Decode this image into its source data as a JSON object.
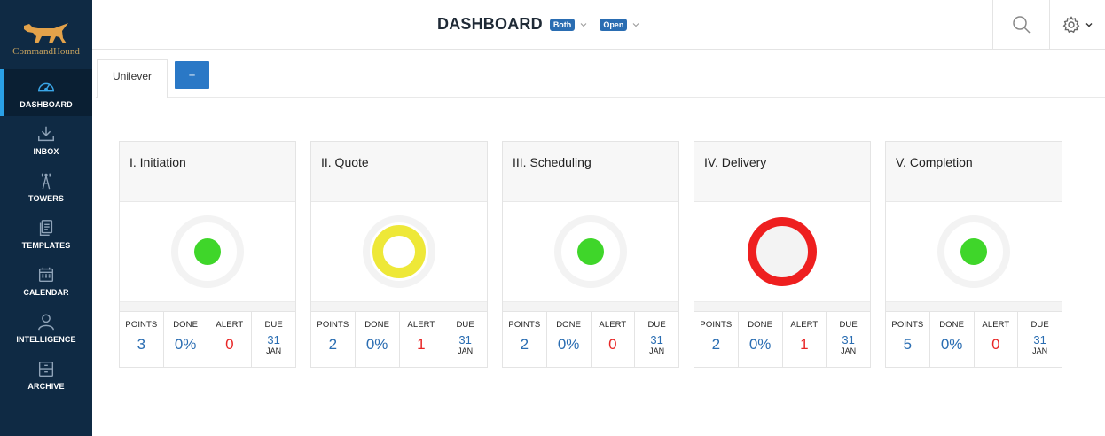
{
  "app": {
    "logo_text": "CommandHound"
  },
  "sidebar": {
    "items": [
      {
        "label": "DASHBOARD",
        "icon": "speedometer-icon",
        "active": true
      },
      {
        "label": "INBOX",
        "icon": "download-tray-icon"
      },
      {
        "label": "TOWERS",
        "icon": "tower-icon"
      },
      {
        "label": "TEMPLATES",
        "icon": "documents-icon"
      },
      {
        "label": "CALENDAR",
        "icon": "calendar-icon"
      },
      {
        "label": "INTELLIGENCE",
        "icon": "person-icon"
      },
      {
        "label": "ARCHIVE",
        "icon": "archive-box-icon"
      }
    ]
  },
  "header": {
    "title": "DASHBOARD",
    "filter1": "Both",
    "filter2": "Open",
    "search_icon": "search-icon",
    "settings_icon": "gear-icon"
  },
  "tabs": {
    "active": "Unilever",
    "add_label": "+"
  },
  "stat_labels": {
    "points": "POINTS",
    "done": "DONE",
    "alert": "ALERT",
    "due": "DUE"
  },
  "cards": [
    {
      "title": "I. Initiation",
      "status": "green",
      "points": "3",
      "done": "0%",
      "alert": "0",
      "due_day": "31",
      "due_month": "JAN"
    },
    {
      "title": "II. Quote",
      "status": "yellow",
      "points": "2",
      "done": "0%",
      "alert": "1",
      "due_day": "31",
      "due_month": "JAN"
    },
    {
      "title": "III. Scheduling",
      "status": "green",
      "points": "2",
      "done": "0%",
      "alert": "0",
      "due_day": "31",
      "due_month": "JAN"
    },
    {
      "title": "IV. Delivery",
      "status": "red",
      "points": "2",
      "done": "0%",
      "alert": "1",
      "due_day": "31",
      "due_month": "JAN"
    },
    {
      "title": "V. Completion",
      "status": "green",
      "points": "5",
      "done": "0%",
      "alert": "0",
      "due_day": "31",
      "due_month": "JAN"
    }
  ],
  "colors": {
    "green": "#3fd62a",
    "yellow": "#eee838",
    "red": "#ee1f1f",
    "accent": "#2a6db2",
    "sidebar": "#0f2a44"
  }
}
